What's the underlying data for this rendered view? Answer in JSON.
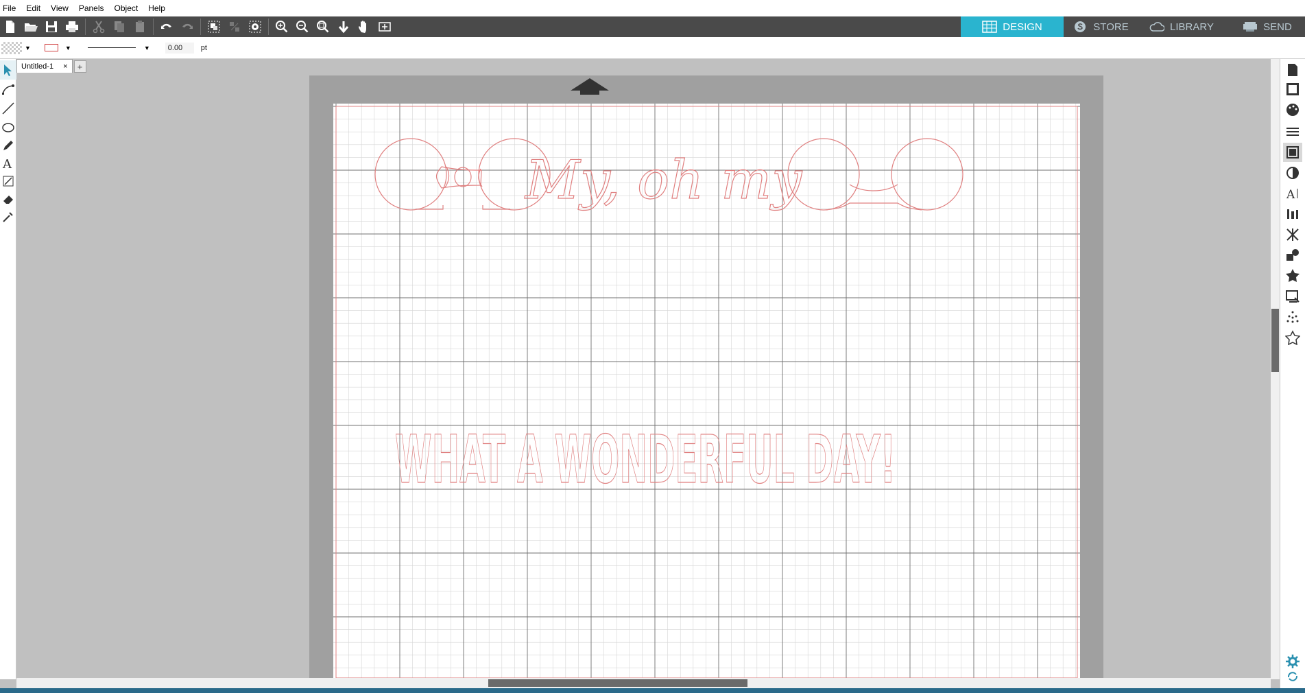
{
  "menubar": {
    "items": [
      "File",
      "Edit",
      "View",
      "Panels",
      "Object",
      "Help"
    ]
  },
  "toolbar": {
    "left_icons": [
      "new-icon",
      "open-icon",
      "save-icon",
      "print-icon",
      "cut-icon",
      "copy-icon",
      "paste-icon",
      "undo-icon",
      "redo-icon",
      "group-icon",
      "ungroup-icon",
      "select-all-icon",
      "zoom-in-icon",
      "zoom-out-icon",
      "zoom-fit-icon",
      "move-down-icon",
      "pan-icon",
      "fit-page-icon"
    ]
  },
  "nav_tabs": [
    {
      "label": "DESIGN",
      "icon": "grid-icon",
      "active": true
    },
    {
      "label": "STORE",
      "icon": "store-icon",
      "active": false
    },
    {
      "label": "LIBRARY",
      "icon": "cloud-icon",
      "active": false
    },
    {
      "label": "SEND",
      "icon": "cutter-icon",
      "active": false
    }
  ],
  "propbar": {
    "line_width_value": "0.00",
    "line_width_unit": "pt"
  },
  "document": {
    "tab_label": "Untitled-1",
    "close_symbol": "×",
    "add_symbol": "+"
  },
  "design": {
    "script_text": "My, oh my",
    "headline_text": "WHAT A WONDERFUL DAY!",
    "stroke_color": "#e08080"
  },
  "colors": {
    "toolbar_bg": "#4a4a4a",
    "design_tab": "#2ab4cf",
    "mat": "#a0a0a0",
    "workspace": "#c0c0c0"
  }
}
